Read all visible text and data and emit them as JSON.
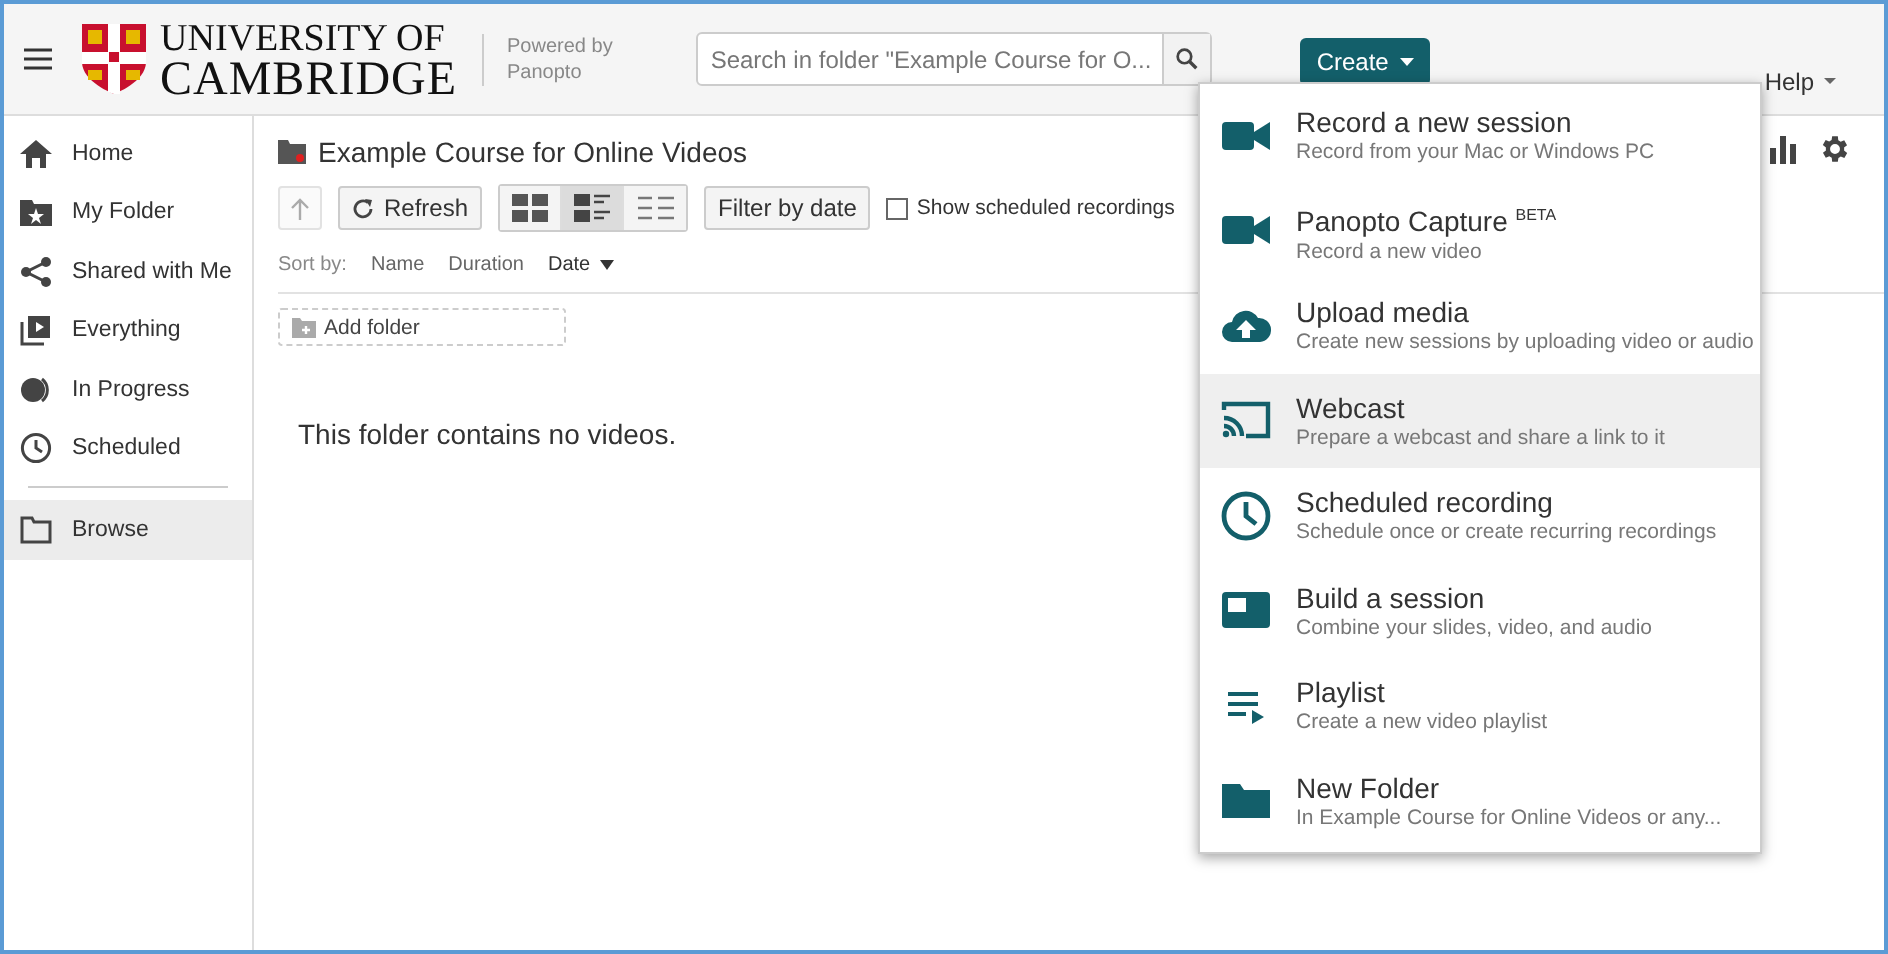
{
  "header": {
    "logo_line1": "UNIVERSITY OF",
    "logo_line2": "CAMBRIDGE",
    "powered_by": "Powered by",
    "powered_by_brand": "Panopto",
    "search": {
      "placeholder": "Search in folder \"Example Course for O..."
    },
    "create_button": "Create",
    "help": "Help"
  },
  "sidebar": {
    "items": [
      {
        "label": "Home",
        "kind": "home",
        "selected": false
      },
      {
        "label": "My Folder",
        "kind": "myfolder",
        "selected": false
      },
      {
        "label": "Shared with Me",
        "kind": "share",
        "selected": false
      },
      {
        "label": "Everything",
        "kind": "everything",
        "selected": false
      },
      {
        "label": "In Progress",
        "kind": "progress",
        "selected": false
      },
      {
        "label": "Scheduled",
        "kind": "clock",
        "selected": false
      }
    ],
    "browse": {
      "label": "Browse",
      "selected": true
    }
  },
  "folder": {
    "title": "Example Course for Online Videos",
    "refresh": "Refresh",
    "views": [
      {
        "kind": "grid",
        "selected": false
      },
      {
        "kind": "detail",
        "selected": true
      },
      {
        "kind": "list",
        "selected": false
      }
    ],
    "filter": "Filter by date",
    "show_scheduled": {
      "label": "Show scheduled recordings",
      "checked": false
    },
    "sort_label": "Sort by:",
    "sort_options": [
      {
        "label": "Name",
        "selected": false
      },
      {
        "label": "Duration",
        "selected": false
      },
      {
        "label": "Date",
        "selected": true
      }
    ],
    "add_folder": "Add folder",
    "empty_message": "This folder contains no videos."
  },
  "create_menu": {
    "items": [
      {
        "kind": "camera",
        "title": "Record a new session",
        "subtitle": "Record from your Mac or Windows PC",
        "selected": false
      },
      {
        "kind": "camera",
        "title": "Panopto Capture",
        "badge": "BETA",
        "subtitle": "Record a new video",
        "selected": false
      },
      {
        "kind": "upload",
        "title": "Upload media",
        "subtitle": "Create new sessions by uploading video or audio",
        "selected": false
      },
      {
        "kind": "cast",
        "title": "Webcast",
        "subtitle": "Prepare a webcast and share a link to it",
        "selected": true
      },
      {
        "kind": "clock",
        "title": "Scheduled recording",
        "subtitle": "Schedule once or create recurring recordings",
        "selected": false
      },
      {
        "kind": "build",
        "title": "Build a session",
        "subtitle": "Combine your slides, video, and audio",
        "selected": false
      },
      {
        "kind": "playlist",
        "title": "Playlist",
        "subtitle": "Create a new video playlist",
        "selected": false
      },
      {
        "kind": "folder",
        "title": "New Folder",
        "subtitle": "In Example Course for Online Videos or any...",
        "selected": false
      }
    ]
  }
}
